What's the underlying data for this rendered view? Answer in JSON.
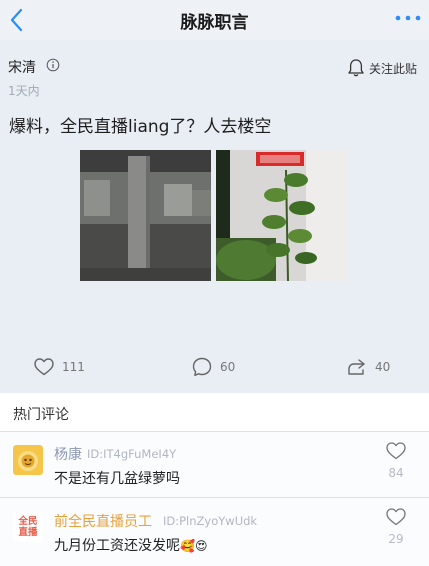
{
  "header": {
    "title": "脉脉职言",
    "back_icon": "chevron-left-icon",
    "more_icon": "ellipsis-icon",
    "accent_color": "#2a8cff"
  },
  "post": {
    "author": "宋清",
    "time": "1天内",
    "follow_label": "关注此贴",
    "text": "爆料，全民直播liang了？人去楼空",
    "images": [
      {
        "description_icon": "empty-office-photo"
      },
      {
        "description_icon": "plant-wall-photo"
      }
    ],
    "likes": "111",
    "comments": "60",
    "shares": "40"
  },
  "hot_comments": {
    "title": "热门评论",
    "items": [
      {
        "name": "杨康",
        "id": "ID:IT4gFuMeI4Y",
        "text": "不是还有几盆绿萝吗",
        "likes": "84",
        "name_color": "#8c98b6"
      },
      {
        "name": "前全民直播员工",
        "id": "ID:PlnZyoYwUdk",
        "text": "九月份工资还没发呢",
        "emoji": "🥰😍",
        "likes": "29",
        "name_color": "#e8a13a",
        "avatar_text": "全民\n直播"
      }
    ]
  }
}
